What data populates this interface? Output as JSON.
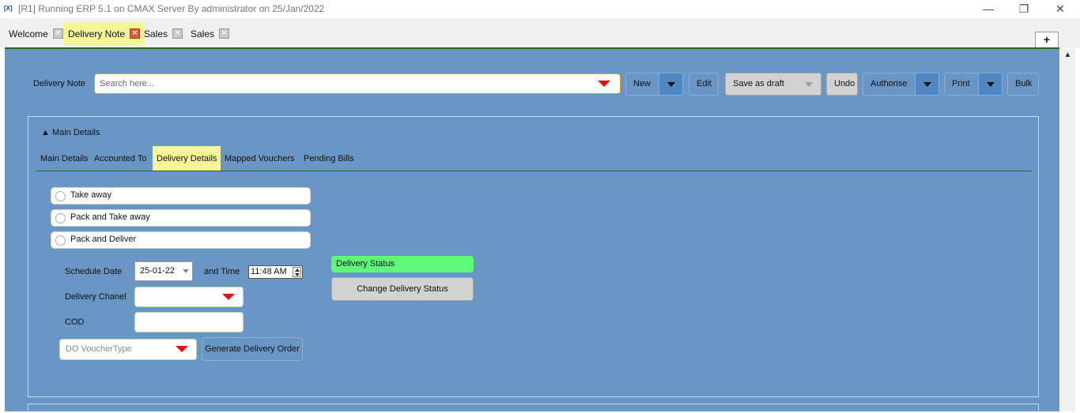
{
  "window": {
    "title": "[R1] Running ERP 5.1 on CMAX Server By administrator on 25/Jan/2022",
    "icon": "app-logo-icon",
    "controls": {
      "minimize": "—",
      "restore": "❐",
      "close": "✕"
    }
  },
  "tabs": [
    {
      "label": "Welcome",
      "active": false
    },
    {
      "label": "Delivery Note",
      "active": true
    },
    {
      "label": "Sales",
      "active": false
    },
    {
      "label": "Sales",
      "active": false
    }
  ],
  "tab_close_glyph": "✕",
  "add_tab_label": "+",
  "toolbar": {
    "module_label": "Delivery Note",
    "search_placeholder": "Search here...",
    "new_label": "New",
    "edit_label": "Edit",
    "save_label": "Save as draft",
    "undo_label": "Undo",
    "authorise_label": "Authorise",
    "print_label": "Print",
    "bulk_label": "Bulk"
  },
  "section": {
    "header": "▲ Main Details",
    "subtabs": [
      {
        "label": "Main Details",
        "active": false
      },
      {
        "label": "Accounted To",
        "active": false
      },
      {
        "label": "Delivery Details",
        "active": true
      },
      {
        "label": "Mapped Vouchers",
        "active": false
      },
      {
        "label": "Pending Bills",
        "active": false
      }
    ]
  },
  "delivery": {
    "options": [
      "Take away",
      "Pack and Take away",
      "Pack and Deliver"
    ],
    "schedule_date_label": "Schedule Date",
    "schedule_date_value": "25-01-22",
    "time_label": "and Time",
    "time_value": "11:48 AM",
    "channel_label": "Delivery Chanel",
    "channel_value": "",
    "cod_label": "COD",
    "cod_value": "",
    "voucher_type_placeholder": "DO VoucherType",
    "generate_label": "Generate Delivery Order",
    "status_label": "Delivery Status",
    "change_status_label": "Change Delivery Status"
  },
  "colors": {
    "panel": "#6a96c6",
    "active_tab": "#f5f59a",
    "status_green": "#5dfa7a",
    "dropdown_red": "#e01010",
    "accent_line": "#1e6e1e"
  }
}
